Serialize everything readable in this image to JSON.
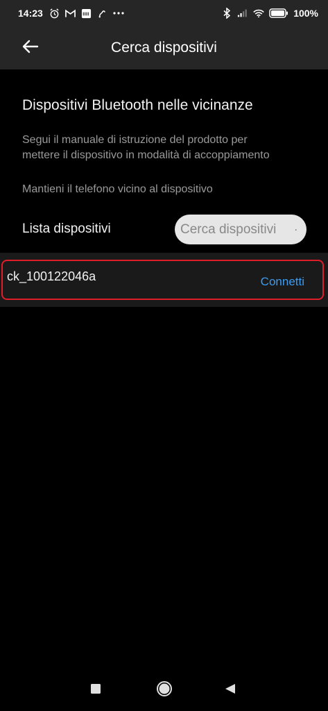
{
  "status_bar": {
    "time": "14:23",
    "battery": "100%",
    "left_icons": [
      "alarm-icon",
      "gmail-icon",
      "ifttt-icon",
      "app-icon",
      "more-icon"
    ],
    "right_icons": [
      "bluetooth-icon",
      "signal-icon",
      "wifi-icon",
      "battery-icon"
    ]
  },
  "app_bar": {
    "title": "Cerca dispositivi",
    "back_icon": "arrow-left-icon"
  },
  "content": {
    "section_title": "Dispositivi Bluetooth nelle vicinanze",
    "instructions": "Segui il manuale di istruzione del prodotto per mettere il dispositivo in modalità di accoppiamento",
    "hint": "Mantieni il telefono vicino al dispositivo",
    "list_label": "Lista dispositivi",
    "search_button": "Cerca dispositivi",
    "search_button_suffix": "."
  },
  "devices": [
    {
      "name": "ck_100122046a",
      "action": "Connetti"
    }
  ],
  "colors": {
    "background": "#000000",
    "bar": "#262626",
    "accent_link": "#3d9bf0",
    "highlight": "#e01e2a"
  },
  "nav_bar": [
    "recents-icon",
    "home-icon",
    "back-icon"
  ]
}
